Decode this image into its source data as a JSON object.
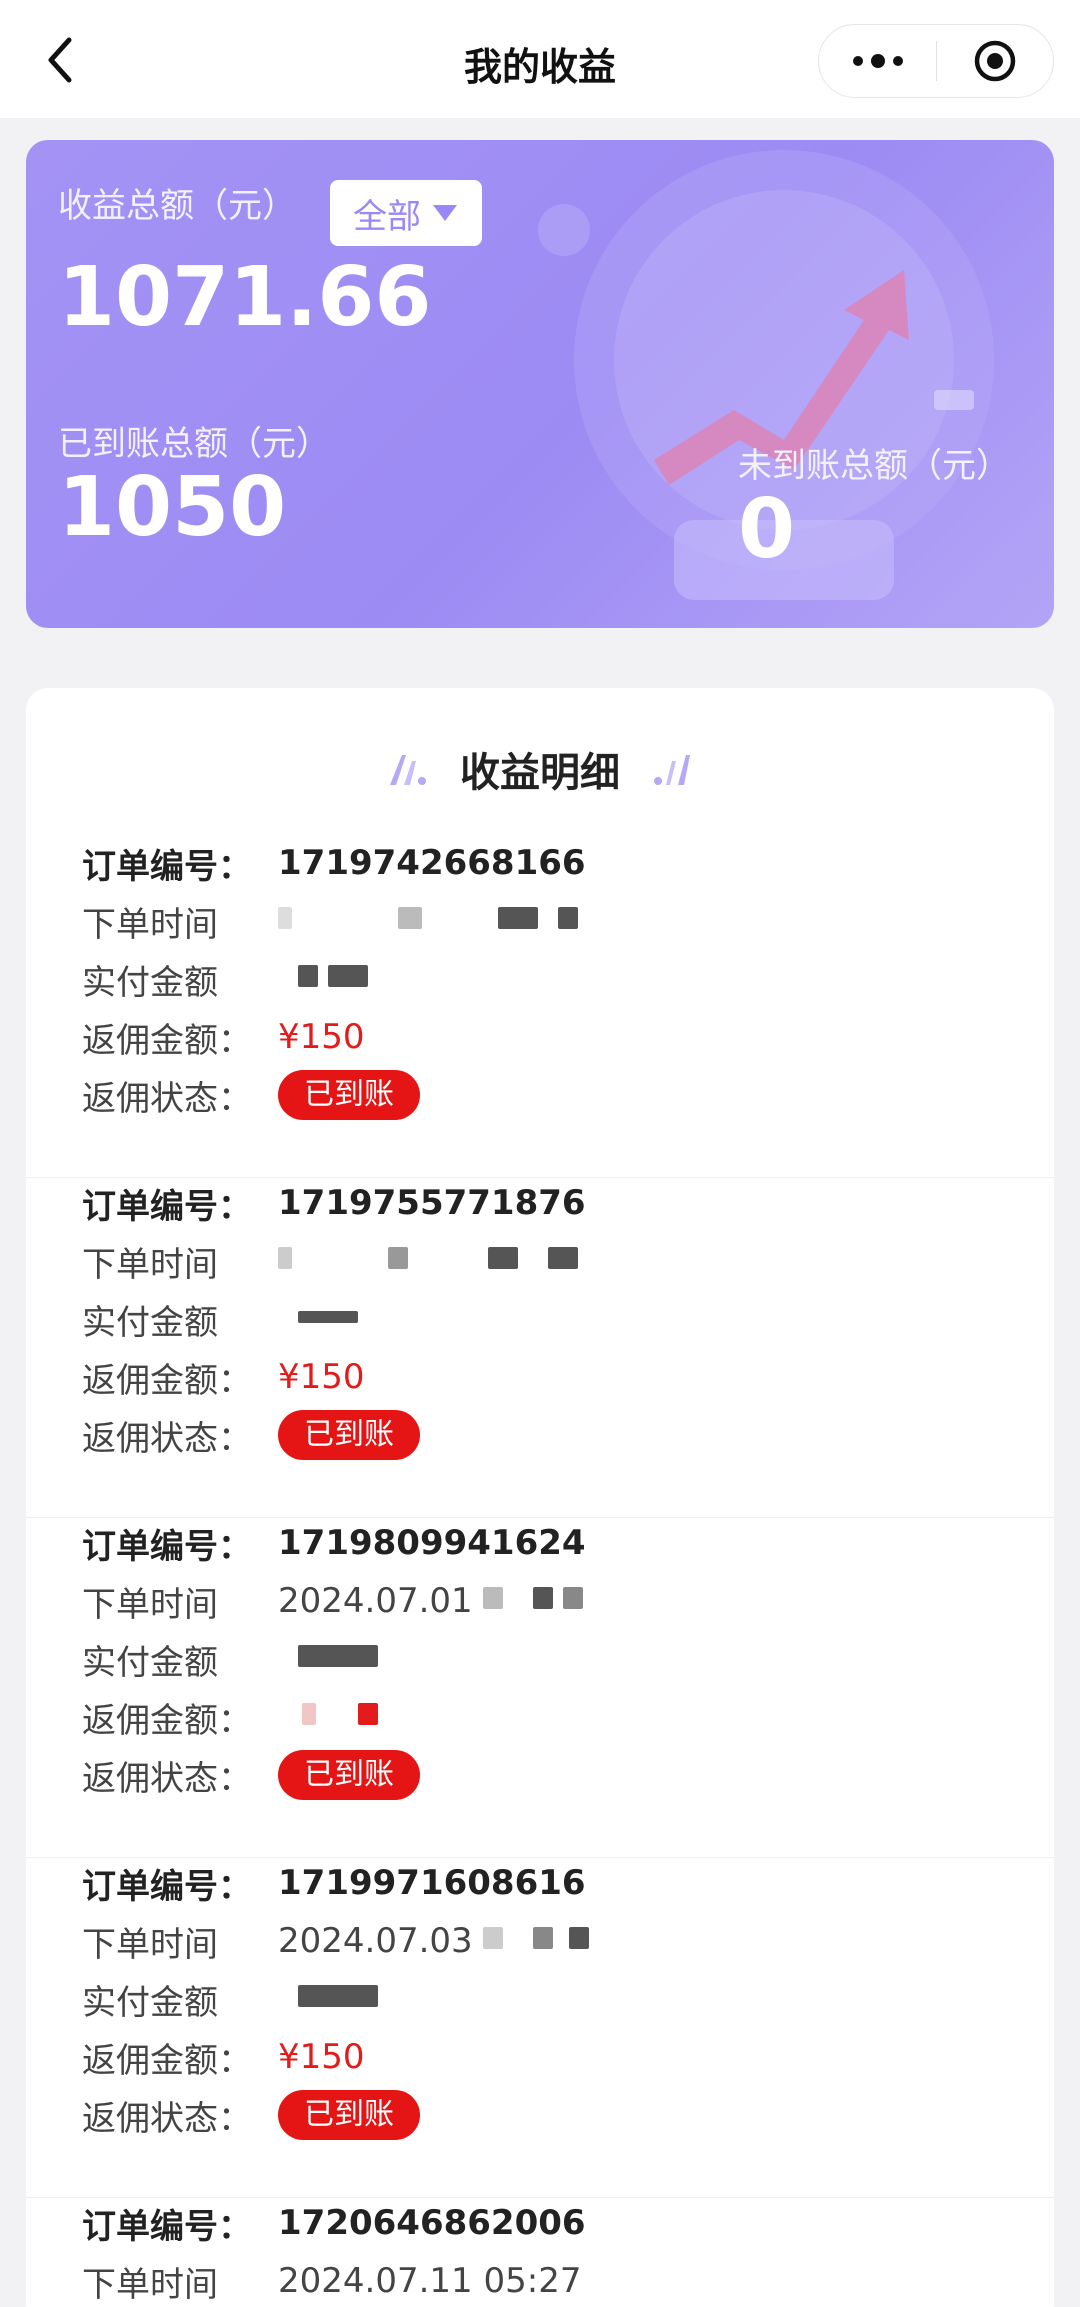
{
  "header": {
    "title": "我的收益",
    "back_icon": "chevron-left-icon",
    "more_icon": "more-dots-icon",
    "close_icon": "target-circle-icon"
  },
  "summary": {
    "total_label": "收益总额（元）",
    "filter_label": "全部",
    "total_value": "1071.66",
    "arrived_label": "已到账总额（元）",
    "arrived_value": "1050",
    "pending_label": "未到账总额（元）",
    "pending_value": "0",
    "accent_color": "#a493f5"
  },
  "detail": {
    "title": "收益明细",
    "labels": {
      "order_no": "订单编号：",
      "order_time": "下单时间",
      "paid_amount": "实付金额",
      "commission": "返佣金额：",
      "status": "返佣状态："
    },
    "orders": [
      {
        "order_no": "1719742668166",
        "order_time": "",
        "commission": "¥150",
        "status": "已到账"
      },
      {
        "order_no": "1719755771876",
        "order_time": "",
        "commission": "¥150",
        "status": "已到账"
      },
      {
        "order_no": "1719809941624",
        "order_time": "2024.07.01",
        "commission": "",
        "status": "已到账"
      },
      {
        "order_no": "1719971608616",
        "order_time": "2024.07.03",
        "commission": "¥150",
        "status": "已到账"
      },
      {
        "order_no": "1720646862006",
        "order_time": "2024.07.11 05:27",
        "commission": "",
        "status": ""
      }
    ],
    "status_color": "#e61515",
    "amount_color": "#e31b1b"
  }
}
